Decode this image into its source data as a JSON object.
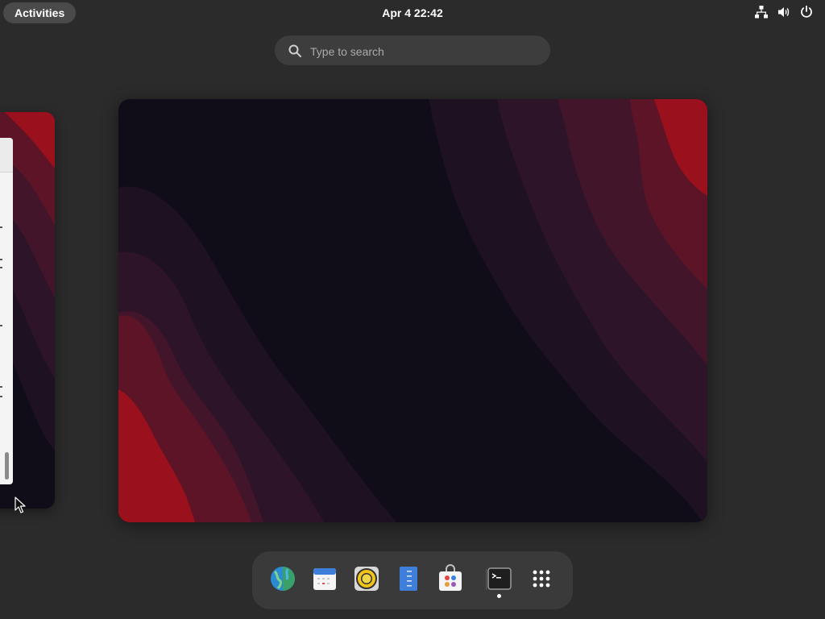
{
  "topbar": {
    "activities_label": "Activities",
    "clock": "Apr 4  22:42",
    "tray_icons": [
      "network-wired-icon",
      "volume-icon",
      "power-icon"
    ]
  },
  "search": {
    "placeholder": "Type to search",
    "value": ""
  },
  "workspaces": {
    "count": 2,
    "active_index": 1,
    "wallpaper_colors": [
      "#100d19",
      "#1e1121",
      "#2d1428",
      "#43152b",
      "#5e1427",
      "#7b1221",
      "#9a101c"
    ]
  },
  "dock": {
    "apps": [
      {
        "name": "Web Browser",
        "icon": "globe-icon",
        "running": false
      },
      {
        "name": "Calendar",
        "icon": "calendar-icon",
        "running": false
      },
      {
        "name": "Music Player",
        "icon": "speaker-icon",
        "running": false
      },
      {
        "name": "Text Editor",
        "icon": "text-editor-icon",
        "running": false
      },
      {
        "name": "Software",
        "icon": "software-store-icon",
        "running": false
      },
      {
        "name": "Terminal",
        "icon": "terminal-icon",
        "running": true
      },
      {
        "name": "Show Apps",
        "icon": "app-grid-icon",
        "running": false
      }
    ]
  }
}
